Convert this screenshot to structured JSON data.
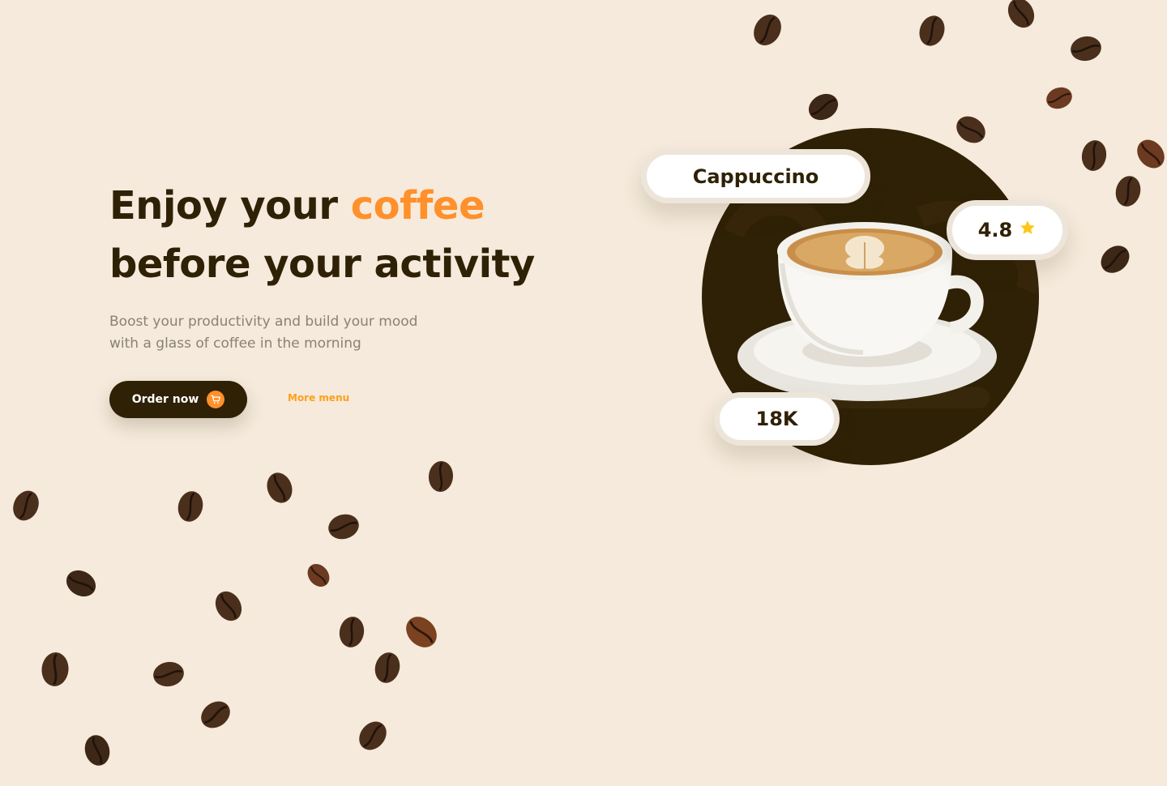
{
  "hero": {
    "title_part1": "Enjoy your ",
    "title_accent": "coffee",
    "title_line2": "before your activity",
    "subtitle": "Boost your productivity and build your mood with a glass of coffee in the morning"
  },
  "actions": {
    "order_label": "Order now",
    "more_label": "More menu"
  },
  "product": {
    "name": "Cappuccino",
    "rating": "4.8",
    "count": "18K"
  },
  "icons": {
    "cart": "cart-icon",
    "star": "star-icon",
    "bean": "coffee-bean-icon"
  },
  "colors": {
    "background": "#f5eadb",
    "dark": "#2f2105",
    "accent": "#ff902b",
    "link": "#ff9f1a",
    "star": "#ffc61a"
  }
}
